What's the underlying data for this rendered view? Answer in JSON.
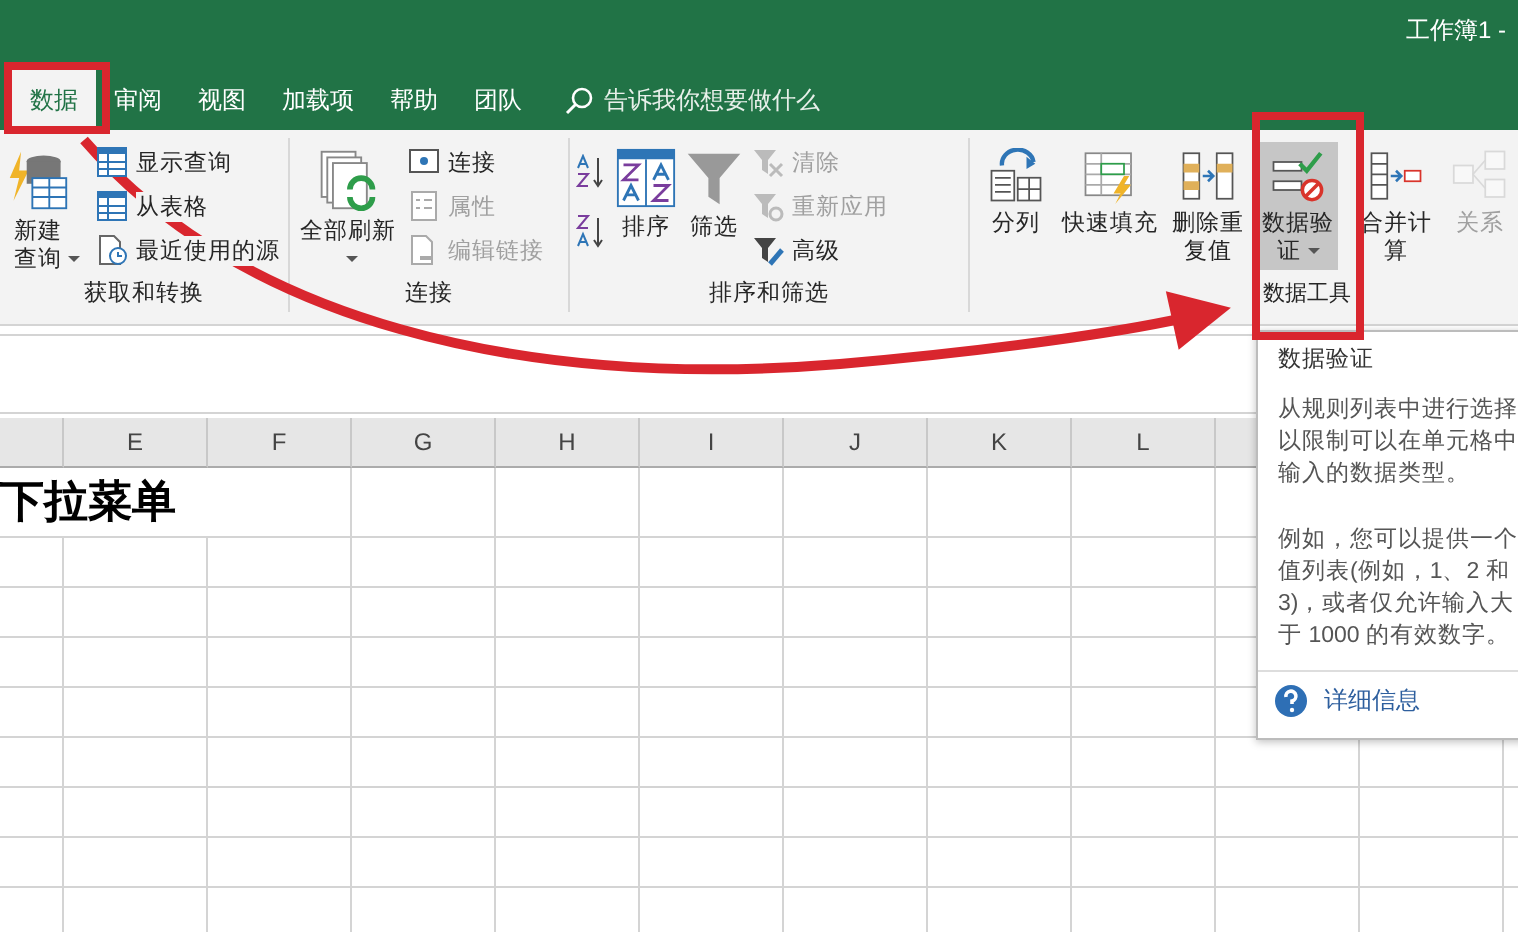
{
  "window": {
    "title": "工作簿1 -"
  },
  "tabs": [
    {
      "label": "数据",
      "selected": true
    },
    {
      "label": "审阅",
      "selected": false
    },
    {
      "label": "视图",
      "selected": false
    },
    {
      "label": "加载项",
      "selected": false
    },
    {
      "label": "帮助",
      "selected": false
    },
    {
      "label": "团队",
      "selected": false
    }
  ],
  "tell_me": {
    "placeholder": "告诉我你想要做什么"
  },
  "ribbon": {
    "groups": [
      {
        "label": "获取和转换",
        "items": [
          {
            "kind": "large",
            "label": "新建查询",
            "dropdown": true,
            "disabled": false,
            "selected": false
          },
          {
            "kind": "small",
            "label": "显示查询",
            "disabled": false
          },
          {
            "kind": "small",
            "label": "从表格",
            "disabled": false
          },
          {
            "kind": "small",
            "label": "最近使用的源",
            "disabled": false
          }
        ]
      },
      {
        "label": "连接",
        "items": [
          {
            "kind": "large",
            "label": "全部刷新",
            "dropdown": true,
            "disabled": false,
            "selected": false
          },
          {
            "kind": "small",
            "label": "连接",
            "disabled": false
          },
          {
            "kind": "small",
            "label": "属性",
            "disabled": true
          },
          {
            "kind": "small",
            "label": "编辑链接",
            "disabled": true
          }
        ]
      },
      {
        "label": "排序和筛选",
        "items": [
          {
            "kind": "icon",
            "disabled": false
          },
          {
            "kind": "large",
            "label": "排序",
            "dropdown": false,
            "disabled": false,
            "selected": false
          },
          {
            "kind": "large",
            "label": "筛选",
            "dropdown": false,
            "disabled": false,
            "selected": false
          },
          {
            "kind": "small",
            "label": "清除",
            "disabled": true
          },
          {
            "kind": "small",
            "label": "重新应用",
            "disabled": true
          },
          {
            "kind": "small",
            "label": "高级",
            "disabled": false
          }
        ]
      },
      {
        "label": "数据工具",
        "items": [
          {
            "kind": "large",
            "label": "分列",
            "dropdown": false,
            "disabled": false,
            "selected": false
          },
          {
            "kind": "large",
            "label": "快速填充",
            "dropdown": false,
            "disabled": false,
            "selected": false
          },
          {
            "kind": "large",
            "label": "删除重复值",
            "dropdown": false,
            "disabled": false,
            "selected": false
          },
          {
            "kind": "large",
            "label": "数据验证",
            "dropdown": true,
            "disabled": false,
            "selected": true
          },
          {
            "kind": "large",
            "label": "合并计算",
            "dropdown": false,
            "disabled": false,
            "selected": false
          },
          {
            "kind": "large",
            "label": "关系",
            "dropdown": false,
            "disabled": true,
            "selected": false
          }
        ]
      }
    ]
  },
  "sheet": {
    "columns": [
      "E",
      "F",
      "G",
      "H",
      "I",
      "J",
      "K",
      "L"
    ],
    "cell_text": "下拉菜单"
  },
  "tooltip": {
    "title": "数据验证",
    "paragraphs": [
      [
        "从规则列表中进行选择",
        "以限制可以在单元格中",
        "输入的数据类型。"
      ],
      [
        "例如，您可以提供一个",
        "值列表(例如，1、2 和",
        "3)，或者仅允许输入大",
        "于 1000 的有效数字。"
      ]
    ],
    "link": "详细信息"
  }
}
